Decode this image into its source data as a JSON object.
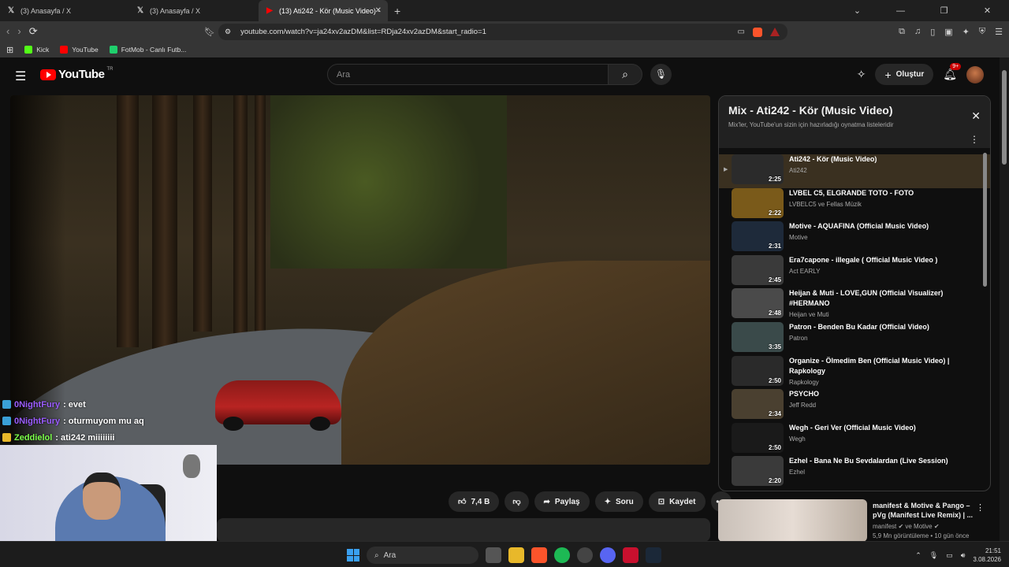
{
  "tabs": [
    {
      "label": "(3) Anasayfa / X",
      "icon": "x-logo-icon"
    },
    {
      "label": "(3) Anasayfa / X",
      "icon": "x-logo-icon"
    },
    {
      "label": "(13) Ati242 - Kör (Music Video) -",
      "icon": "youtube-icon"
    }
  ],
  "address": {
    "url": "youtube.com/watch?v=ja24xv2azDM&list=RDja24xv2azDM&start_radio=1"
  },
  "bookmarks": [
    {
      "label": "Kick",
      "color": "#53fc18"
    },
    {
      "label": "YouTube",
      "color": "#ff0000"
    },
    {
      "label": "FotMob - Canlı Futb...",
      "color": "#1fcf6c"
    }
  ],
  "yt": {
    "logo": "YouTube",
    "region": "TR",
    "search_placeholder": "Ara",
    "create": "Oluştur",
    "notif_badge": "9+"
  },
  "chat": [
    {
      "user": "0NightFury",
      "msg": ": evet",
      "color": "#9b5cff",
      "badge": "tw"
    },
    {
      "user": "0NightFury",
      "msg": ": oturmuyom mu aq",
      "color": "#9b5cff",
      "badge": "tw"
    },
    {
      "user": "Zeddielol",
      "msg": ": ati242 miiiiiiii",
      "color": "#7cff4a",
      "badge": "crown"
    }
  ],
  "actions": {
    "likes": "7,4 B",
    "share": "Paylaş",
    "ask": "Soru",
    "save": "Kaydet"
  },
  "playlist": {
    "title": "Mix - Ati242 - Kör (Music Video)",
    "subtitle": "Mix'ler, YouTube'un sizin için hazırladığı oynatma listeleridir",
    "items": [
      {
        "title": "Ati242 - Kör (Music Video)",
        "channel": "Ati242",
        "duration": "2:25",
        "current": true,
        "thumb": "#2b2b2b"
      },
      {
        "title": "LVBEL C5, ELGRANDE TOTO - FOTO",
        "channel": "LVBELC5 ve Fellas Müzik",
        "duration": "2:22",
        "current": false,
        "thumb": "#7a5a1a"
      },
      {
        "title": "Motive - AQUAFINA (Official Music Video)",
        "channel": "Motive",
        "duration": "2:31",
        "current": false,
        "thumb": "#1e2a3a"
      },
      {
        "title": "Era7capone - illegale ( Official Music Video )",
        "channel": "Act EARLY",
        "duration": "2:45",
        "current": false,
        "thumb": "#3a3a3a"
      },
      {
        "title": "Heijan & Muti - LOVE,GUN (Official Visualizer) #HERMANO",
        "channel": "Heijan ve Muti",
        "duration": "2:48",
        "current": false,
        "thumb": "#4a4a4a"
      },
      {
        "title": "Patron - Benden Bu Kadar (Official Video)",
        "channel": "Patron",
        "duration": "3:35",
        "current": false,
        "thumb": "#3a4a4a"
      },
      {
        "title": "Organize - Ölmedim Ben (Official Music Video) | Rapkology",
        "channel": "Rapkology",
        "duration": "2:50",
        "current": false,
        "thumb": "#2a2a2a"
      },
      {
        "title": "PSYCHO",
        "channel": "Jeff Redd",
        "duration": "2:34",
        "current": false,
        "thumb": "#4a4030"
      },
      {
        "title": "Wegh - Geri Ver (Official Music Video)",
        "channel": "Wegh",
        "duration": "2:50",
        "current": false,
        "thumb": "#1a1a1a"
      },
      {
        "title": "Ezhel - Bana Ne Bu Sevdalardan (Live Session)",
        "channel": "Ezhel",
        "duration": "2:20",
        "current": false,
        "thumb": "#3a3a3a"
      }
    ]
  },
  "recommended": {
    "title": "manifest & Motive & Pango – pVg (Manifest Live Remix) | ...",
    "channel": "manifest ✔ ve Motive ✔",
    "views": "5,9 Mn görüntüleme • 10 gün önce"
  },
  "taskbar": {
    "search": "Ara",
    "time": "21:51",
    "date": "3.08.2026"
  }
}
